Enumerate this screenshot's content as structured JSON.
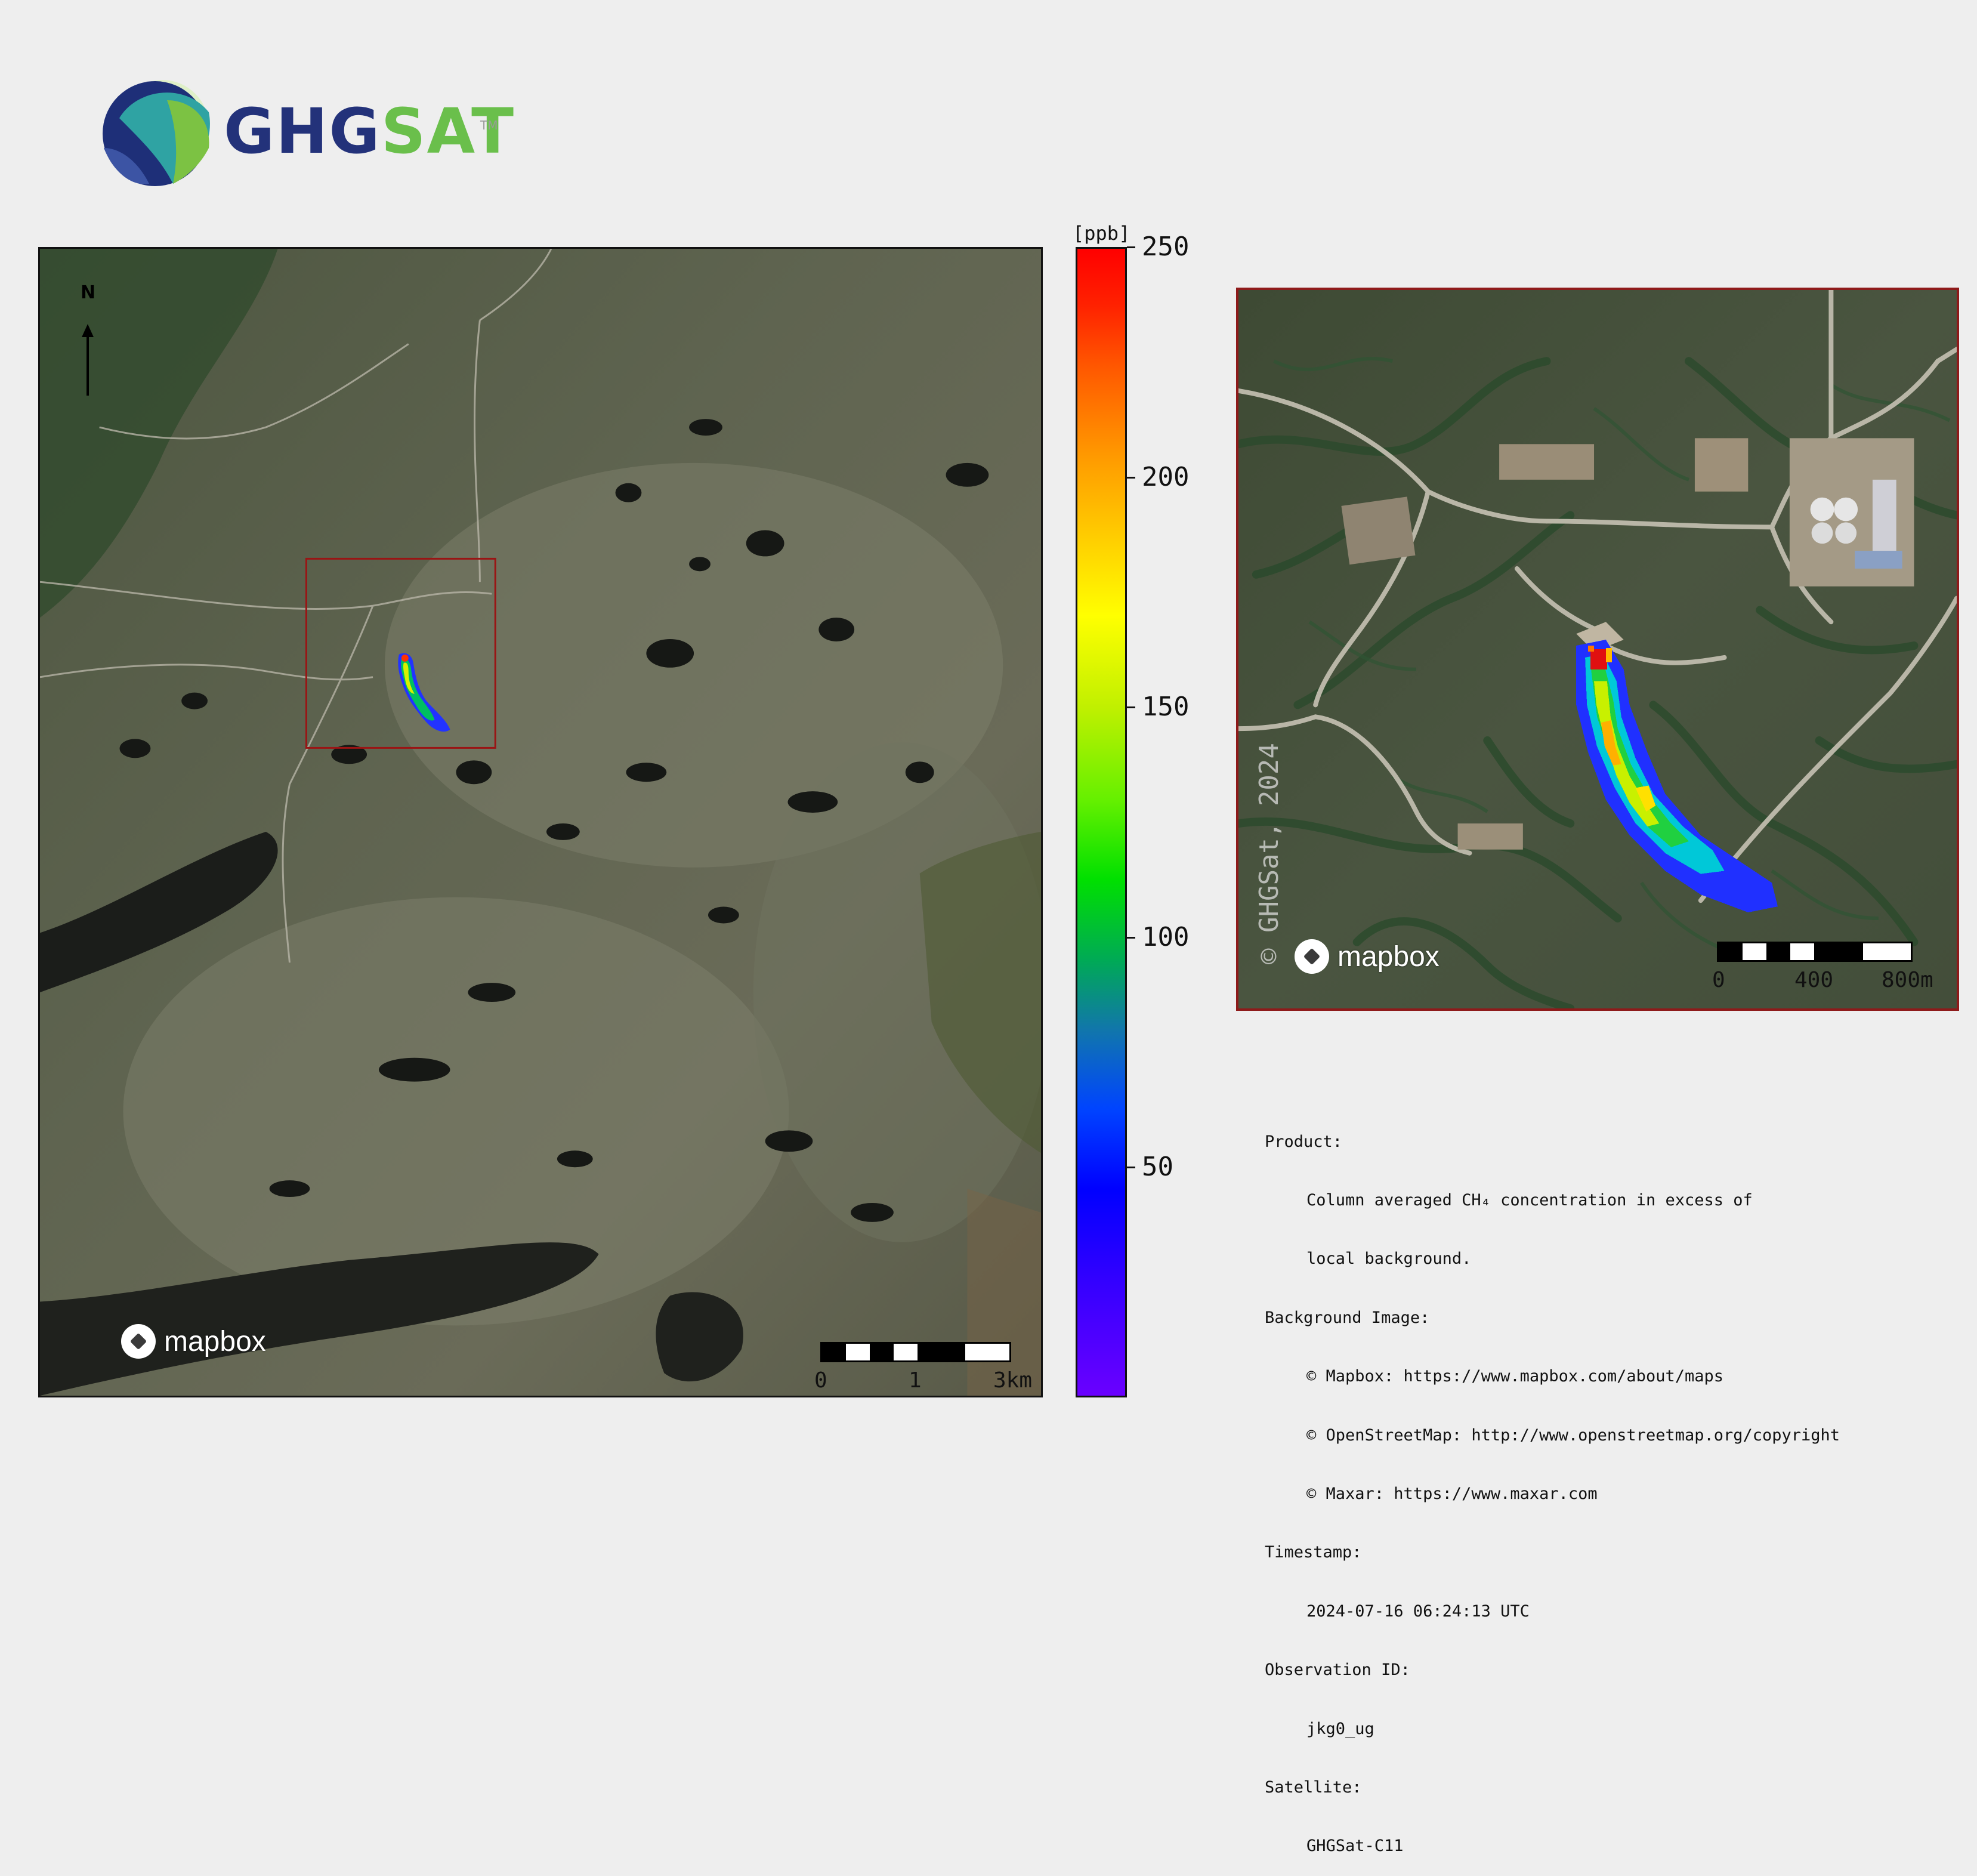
{
  "logo": {
    "text_primary": "GHG",
    "text_secondary": "SAT",
    "tm": "TM",
    "colors": {
      "primary": "#23327a",
      "secondary": "#6abf4b"
    }
  },
  "main_map": {
    "north_label": "N",
    "attribution_logo": "mapbox",
    "scalebar": {
      "labels": [
        "0",
        "1",
        "3km"
      ]
    },
    "icons": [
      "north-arrow-icon",
      "mapbox-logo-icon"
    ]
  },
  "inset_map": {
    "watermark": "© GHGSat, 2024",
    "attribution_logo": "mapbox",
    "scalebar": {
      "labels": [
        "0",
        "400",
        "800m"
      ]
    },
    "frame_color": "#8e1a1a"
  },
  "colorbar": {
    "unit": "[ppb]",
    "ticks": [
      {
        "value": 250,
        "label": "250"
      },
      {
        "value": 200,
        "label": "200"
      },
      {
        "value": 150,
        "label": "150"
      },
      {
        "value": 100,
        "label": "100"
      },
      {
        "value": 50,
        "label": "50"
      }
    ],
    "min": 0,
    "max": 250,
    "colormap": "rainbow"
  },
  "info": {
    "product_label": "Product:",
    "product_line1": "Column averaged CH₄ concentration in excess of",
    "product_line2": "local background.",
    "background_label": "Background Image:",
    "background_lines": [
      "© Mapbox: https://www.mapbox.com/about/maps",
      "© OpenStreetMap: http://www.openstreetmap.org/copyright",
      "© Maxar: https://www.maxar.com"
    ],
    "timestamp_label": "Timestamp:",
    "timestamp_value": "2024-07-16 06:24:13 UTC",
    "observation_label": "Observation ID:",
    "observation_value": "jkg0_ug",
    "satellite_label": "Satellite:",
    "satellite_value": "GHGSat-C11"
  }
}
